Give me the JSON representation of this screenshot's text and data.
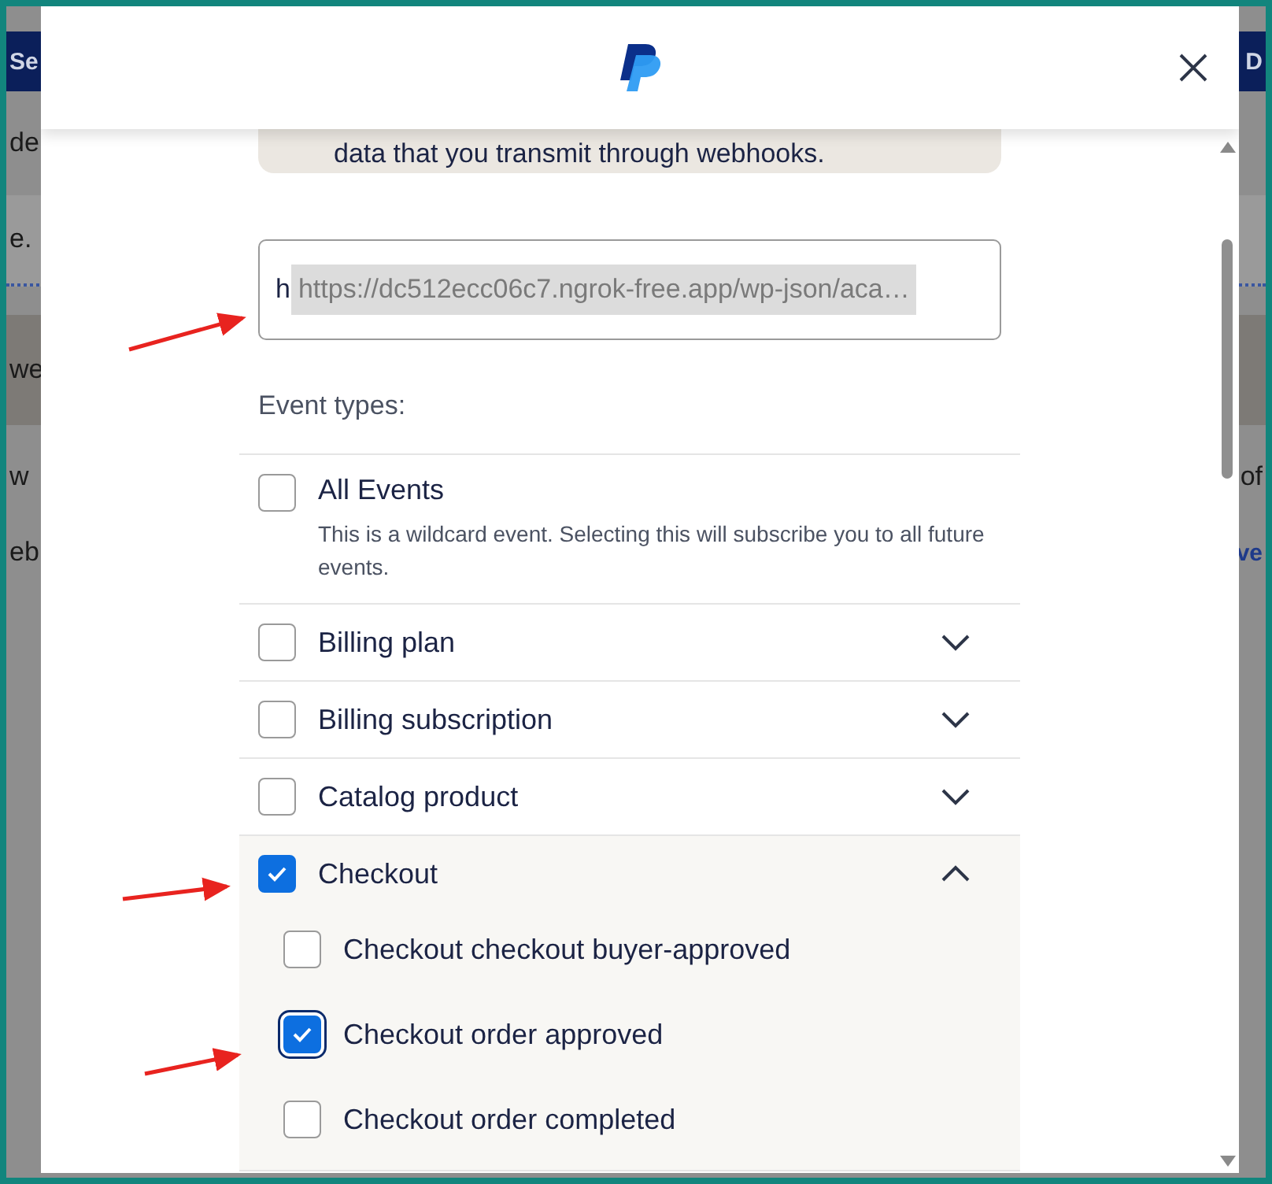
{
  "background": {
    "rows": [
      {
        "kind": "nav",
        "left": "Se",
        "right": "D"
      },
      {
        "kind": "plain",
        "left": "de"
      },
      {
        "kind": "band",
        "left": "e."
      },
      {
        "kind": "dark",
        "left": "we"
      },
      {
        "kind": "plain",
        "left": "w",
        "right": "of"
      },
      {
        "kind": "link",
        "left": "eb",
        "right": "ve"
      }
    ]
  },
  "dialog": {
    "notice": "data that you transmit through webhooks.",
    "url_field": {
      "value": "h",
      "redacted": "https://dc512ecc06c7.ngrok-free.app/wp-json/aca…"
    },
    "event_types_label": "Event types:",
    "all_events": {
      "label": "All Events",
      "description": "This is a wildcard event. Selecting this will subscribe you to all future events.",
      "checked": false
    },
    "events": [
      {
        "label": "Billing plan",
        "checked": false,
        "expanded": false
      },
      {
        "label": "Billing subscription",
        "checked": false,
        "expanded": false
      },
      {
        "label": "Catalog product",
        "checked": false,
        "expanded": false
      },
      {
        "label": "Checkout",
        "checked": true,
        "expanded": true,
        "children": [
          {
            "label": "Checkout checkout buyer-approved",
            "checked": false,
            "focused": false
          },
          {
            "label": "Checkout order approved",
            "checked": true,
            "focused": true
          },
          {
            "label": "Checkout order completed",
            "checked": false,
            "focused": false
          }
        ]
      }
    ]
  }
}
